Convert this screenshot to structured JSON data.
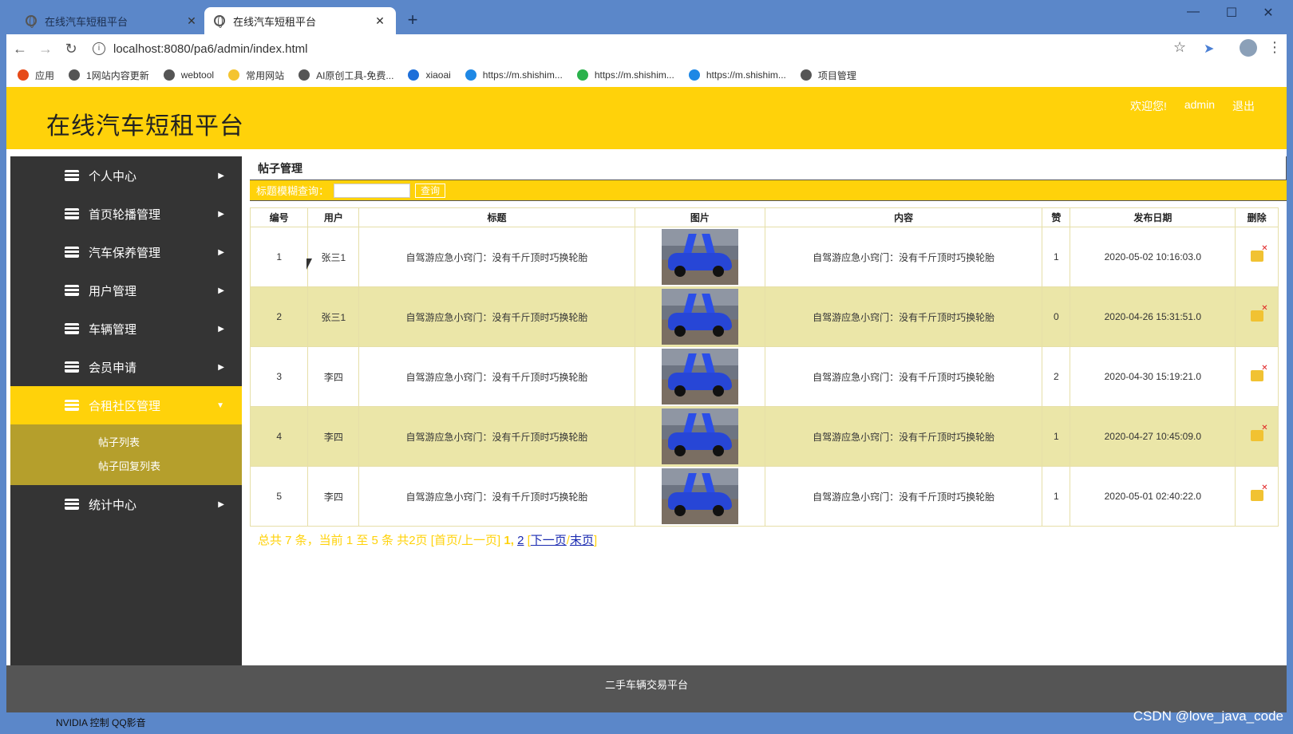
{
  "browser": {
    "tabs": [
      {
        "label": "在线汽车短租平台",
        "close": "✕"
      },
      {
        "label": "在线汽车短租平台",
        "close": "✕"
      }
    ],
    "new_tab": "+",
    "window_controls": {
      "minimize": "—",
      "maximize": "☐",
      "close": "✕"
    },
    "url": "localhost:8080/pa6/admin/index.html",
    "bookmarks": [
      {
        "label": "应用",
        "color": "#e64a19"
      },
      {
        "label": "1网站内容更新",
        "color": "#555555"
      },
      {
        "label": "webtool",
        "color": "#555555"
      },
      {
        "label": "常用网站",
        "color": "#f4c430"
      },
      {
        "label": "AI原创工具-免费...",
        "color": "#555555"
      },
      {
        "label": "xiaoai",
        "color": "#1e6fd9"
      },
      {
        "label": "https://m.shishim...",
        "color": "#1e88e5"
      },
      {
        "label": "https://m.shishim...",
        "color": "#2bb24c"
      },
      {
        "label": "https://m.shishim...",
        "color": "#1e88e5"
      },
      {
        "label": "项目管理",
        "color": "#555555"
      }
    ]
  },
  "header": {
    "title": "在线汽车短租平台",
    "welcome": "欢迎您!",
    "user": "admin",
    "logout": "退出"
  },
  "sidebar": {
    "items": [
      {
        "label": "个人中心"
      },
      {
        "label": "首页轮播管理"
      },
      {
        "label": "汽车保养管理"
      },
      {
        "label": "用户管理"
      },
      {
        "label": "车辆管理"
      },
      {
        "label": "会员申请"
      },
      {
        "label": "合租社区管理",
        "active": true
      },
      {
        "label": "统计中心"
      }
    ],
    "submenu": [
      "帖子列表",
      "帖子回复列表"
    ]
  },
  "main": {
    "panel_title": "帖子管理",
    "search_label": "标题模糊查询：",
    "search_value": "",
    "search_button": "查询",
    "columns": [
      "编号",
      "用户",
      "标题",
      "图片",
      "内容",
      "赞",
      "发布日期",
      "删除"
    ],
    "rows": [
      {
        "id": "1",
        "user": "张三1",
        "title": "自驾游应急小窍门：没有千斤顶时巧换轮胎",
        "content": "自驾游应急小窍门：没有千斤顶时巧换轮胎",
        "likes": "1",
        "date": "2020-05-02 10:16:03.0"
      },
      {
        "id": "2",
        "user": "张三1",
        "title": "自驾游应急小窍门：没有千斤顶时巧换轮胎",
        "content": "自驾游应急小窍门：没有千斤顶时巧换轮胎",
        "likes": "0",
        "date": "2020-04-26 15:31:51.0"
      },
      {
        "id": "3",
        "user": "李四",
        "title": "自驾游应急小窍门：没有千斤顶时巧换轮胎",
        "content": "自驾游应急小窍门：没有千斤顶时巧换轮胎",
        "likes": "2",
        "date": "2020-04-30 15:19:21.0"
      },
      {
        "id": "4",
        "user": "李四",
        "title": "自驾游应急小窍门：没有千斤顶时巧换轮胎",
        "content": "自驾游应急小窍门：没有千斤顶时巧换轮胎",
        "likes": "1",
        "date": "2020-04-27 10:45:09.0"
      },
      {
        "id": "5",
        "user": "李四",
        "title": "自驾游应急小窍门：没有千斤顶时巧换轮胎",
        "content": "自驾游应急小窍门：没有千斤顶时巧换轮胎",
        "likes": "1",
        "date": "2020-05-01 02:40:22.0"
      }
    ],
    "pager": {
      "summary": "总共 7 条，当前 1 至 5 条 共2页 [首页/上一页]",
      "page1": "1,",
      "page2": "2",
      "open_bracket": "[",
      "next": "下一页",
      "slash": "/",
      "last": "末页",
      "close_bracket": "]"
    }
  },
  "footer": {
    "text": "二手车辆交易平台"
  },
  "taskbar": {
    "text": "NVIDIA 控制    QQ影音"
  },
  "watermark": "CSDN @love_java_code",
  "colors": {
    "accent": "#ffd20a",
    "sidebar": "#343434",
    "row_alt": "#ebe6a8",
    "submenu": "#b59f2c"
  }
}
